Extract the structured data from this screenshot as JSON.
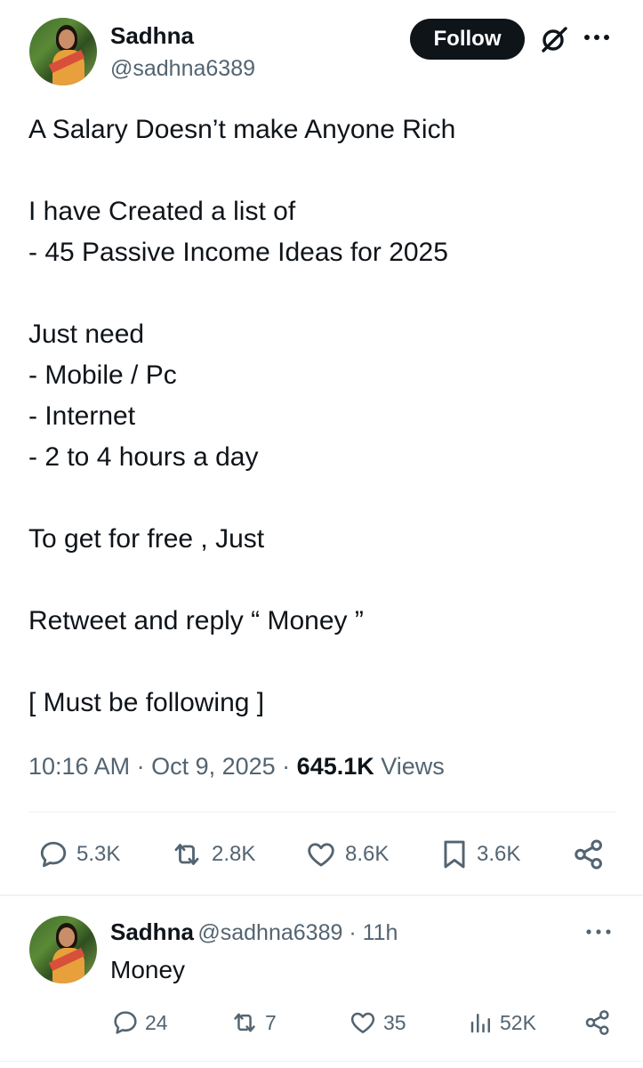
{
  "post": {
    "author_name": "Sadhna",
    "author_handle": "@sadhna6389",
    "follow_label": "Follow",
    "more_label": "···",
    "text_lines": [
      "A Salary Doesn’t make Anyone Rich",
      "",
      "I have Created a list of",
      "- 45 Passive Income Ideas for 2025",
      "",
      "Just need",
      "- Mobile / Pc",
      "- Internet",
      "- 2 to 4 hours a day",
      "",
      "To get for free , Just",
      "",
      "Retweet and reply “ Money ”",
      "",
      "[ Must be following ]"
    ],
    "time": "10:16 AM",
    "date": "Oct 9, 2025",
    "views_count": "645.1K",
    "views_label": "Views",
    "stats": {
      "replies": "5.3K",
      "reposts": "2.8K",
      "likes": "8.6K",
      "bookmarks": "3.6K"
    }
  },
  "reply": {
    "author_name": "Sadhna",
    "author_handle": "@sadhna6389",
    "age": "11h",
    "more_label": "···",
    "text": "Money",
    "stats": {
      "replies": "24",
      "reposts": "7",
      "likes": "35",
      "views": "52K"
    }
  },
  "icons": [
    "reply-icon",
    "repost-icon",
    "like-icon",
    "bookmark-icon",
    "share-icon",
    "views-icon",
    "grok-icon",
    "more-icon"
  ],
  "colors": {
    "text": "#0f1419",
    "muted": "#536471",
    "follow_bg": "#0f1419",
    "divider": "#eff3f4"
  }
}
